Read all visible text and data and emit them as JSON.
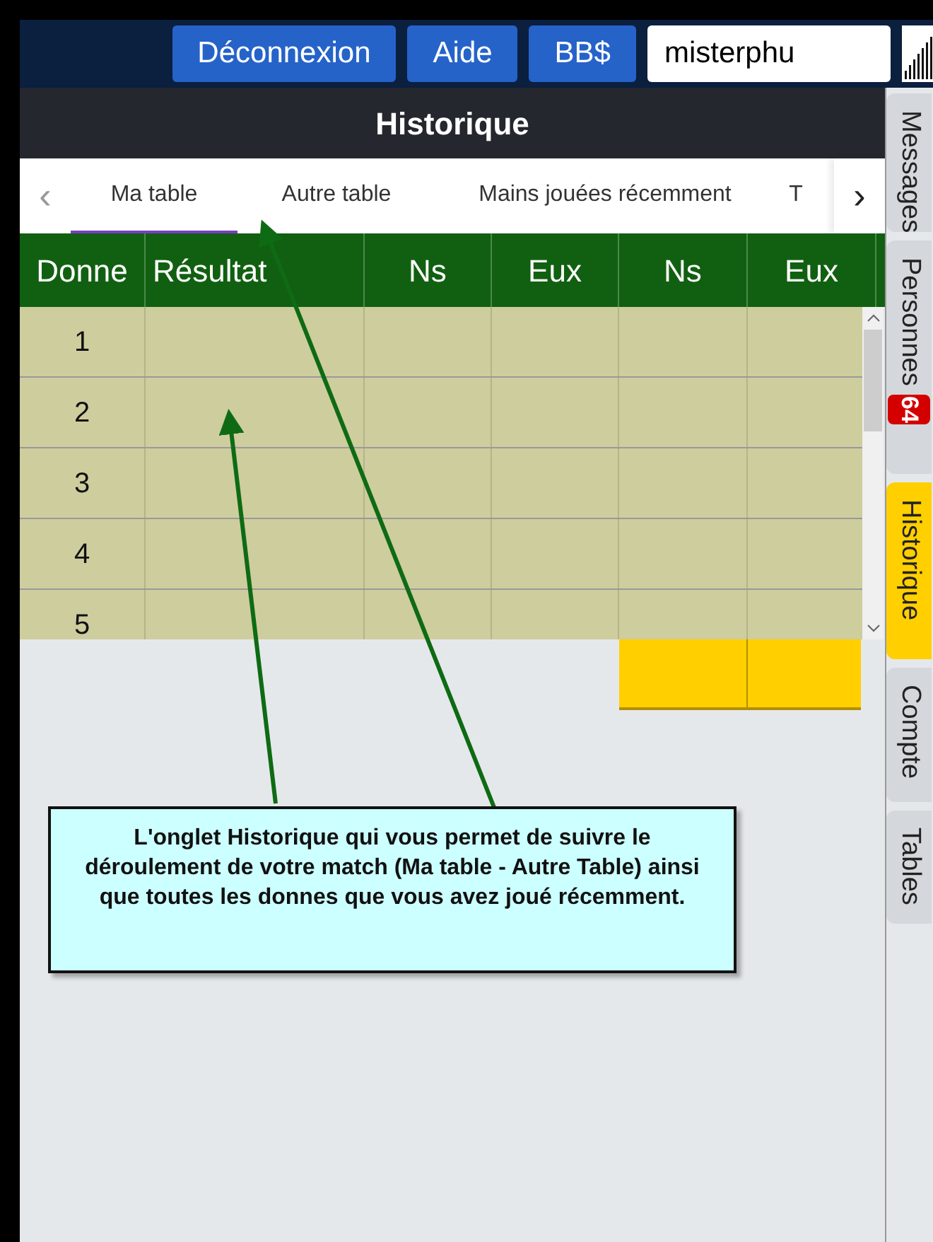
{
  "top_bar": {
    "buttons": [
      "Déconnexion",
      "Aide",
      "BB$"
    ],
    "user_field": {
      "value": "misterphu"
    }
  },
  "panel": {
    "title": "Historique",
    "tabs": [
      {
        "label": "Ma table",
        "selected": true
      },
      {
        "label": "Autre table",
        "selected": false
      },
      {
        "label": "Mains jouées récemment",
        "selected": false
      },
      {
        "label": "T",
        "selected": false
      }
    ],
    "prev": "‹",
    "next": "›",
    "table": {
      "columns": [
        "Donne",
        "Résultat",
        "Ns",
        "Eux",
        "Ns",
        "Eux"
      ],
      "rows": [
        {
          "donne": "1"
        },
        {
          "donne": "2"
        },
        {
          "donne": "3"
        },
        {
          "donne": "4"
        },
        {
          "donne": "5"
        }
      ]
    }
  },
  "side_tabs": [
    {
      "label": "Messages",
      "selected": false
    },
    {
      "label": "Personnes",
      "selected": false,
      "badge": "64"
    },
    {
      "label": "Historique",
      "selected": true
    },
    {
      "label": "Compte",
      "selected": false
    },
    {
      "label": "Tables",
      "selected": false
    }
  ],
  "annotation": {
    "text": "L'onglet Historique qui vous permet de suivre le déroulement de votre match (Ma table - Autre Table) ainsi que toutes les donnes que vous avez joué récemment."
  }
}
